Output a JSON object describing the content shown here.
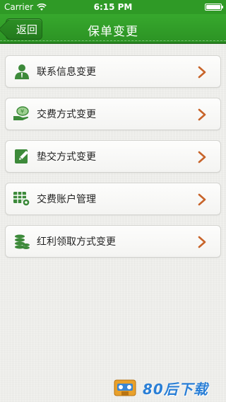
{
  "status_bar": {
    "carrier": "Carrier",
    "time": "6:15 PM"
  },
  "nav": {
    "back_label": "返回",
    "title": "保单变更"
  },
  "menu": [
    {
      "label": "联系信息变更",
      "icon": "contact-person-icon"
    },
    {
      "label": "交费方式变更",
      "icon": "payment-hand-icon"
    },
    {
      "label": "垫交方式变更",
      "icon": "edit-note-icon"
    },
    {
      "label": "交费账户管理",
      "icon": "account-settings-icon"
    },
    {
      "label": "红利领取方式变更",
      "icon": "coin-stack-icon"
    }
  ],
  "watermark": {
    "text": "80后下载"
  },
  "colors": {
    "brand_green": "#2f9a26",
    "chevron_orange": "#c8642a",
    "icon_green": "#3d8a3a"
  }
}
